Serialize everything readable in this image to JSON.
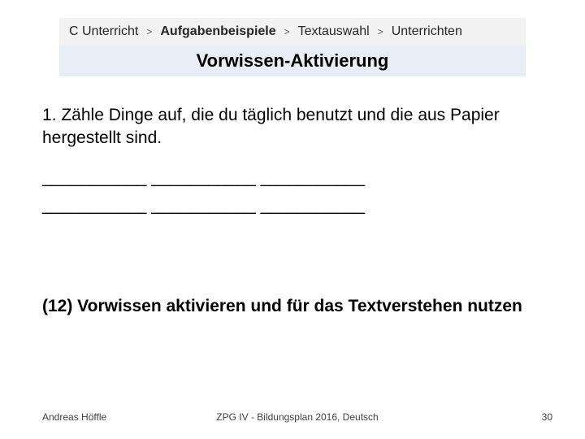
{
  "breadcrumb": {
    "items": [
      {
        "label": "C Unterricht"
      },
      {
        "label": "Aufgabenbeispiele"
      },
      {
        "label": "Textauswahl"
      },
      {
        "label": "Unterrichten"
      }
    ],
    "active_index": 1,
    "separator": ">"
  },
  "title": "Vorwissen-Aktivierung",
  "body": {
    "prompt": "1. Zähle Dinge auf, die du täglich benutzt und die aus Papier hergestellt sind.",
    "blank_lines": [
      "___________ ___________ ___________",
      "___________ ___________ ___________"
    ],
    "strategy": "(12) Vorwissen aktivieren und für das Textverstehen nutzen"
  },
  "footer": {
    "author": "Andreas Höffle",
    "center": "ZPG IV - Bildungsplan 2016, Deutsch",
    "page": "30"
  }
}
